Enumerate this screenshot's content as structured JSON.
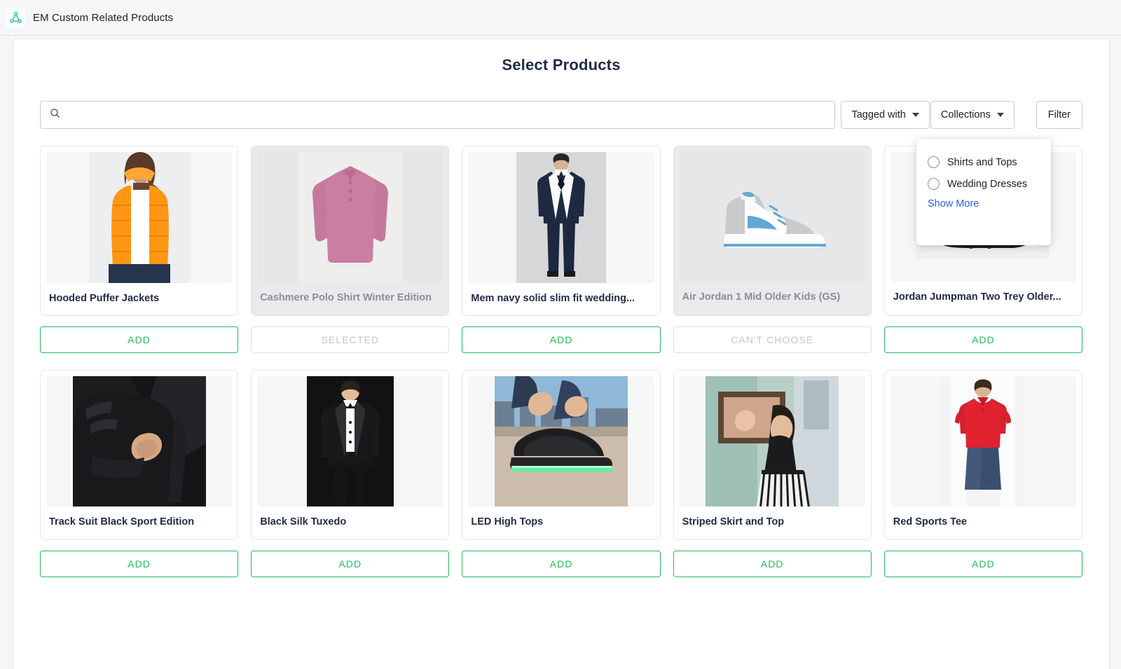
{
  "appbar": {
    "icon": "network-graph-icon",
    "title": "EM Custom Related Products",
    "accent": "#2ec4a6"
  },
  "page": {
    "title": "Select Products"
  },
  "search": {
    "icon": "search-icon",
    "value": "",
    "placeholder": ""
  },
  "toolbar": {
    "tagged_with_label": "Tagged with",
    "collections_label": "Collections",
    "filter_label": "Filter"
  },
  "collections_popover": {
    "options": [
      {
        "label": "Shirts and Tops",
        "selected": false
      },
      {
        "label": "Wedding Dresses",
        "selected": false
      }
    ],
    "show_more_label": "Show More",
    "link_color": "#2c5fe0"
  },
  "labels": {
    "add": "ADD",
    "selected": "SELECTED",
    "cant_choose": "CAN'T CHOOSE"
  },
  "colors": {
    "add_green": "#22bb5b",
    "muted": "#c3c6c9",
    "title": "#1f2b45"
  },
  "products": [
    {
      "title": "Hooded Puffer Jackets",
      "action": "ADD",
      "state": "default",
      "art": "puffer-jacket"
    },
    {
      "title": "Cashmere Polo Shirt Winter Edition",
      "action": "SELECTED",
      "state": "selected",
      "art": "polo-shirt"
    },
    {
      "title": "Mem navy solid slim fit wedding...",
      "action": "ADD",
      "state": "default",
      "art": "navy-suit"
    },
    {
      "title": "Air Jordan 1 Mid Older Kids (GS)",
      "action": "CAN'T CHOOSE",
      "state": "disabled",
      "art": "jordan-1-sneaker"
    },
    {
      "title": "Jordan Jumpman Two Trey Older...",
      "action": "ADD",
      "state": "default",
      "art": "jumpman-sneaker"
    },
    {
      "title": "Track Suit Black Sport Edition",
      "action": "ADD",
      "state": "default",
      "art": "track-suit"
    },
    {
      "title": "Black Silk Tuxedo",
      "action": "ADD",
      "state": "default",
      "art": "black-tuxedo"
    },
    {
      "title": "LED High Tops",
      "action": "ADD",
      "state": "default",
      "art": "led-high-tops"
    },
    {
      "title": "Striped Skirt and Top",
      "action": "ADD",
      "state": "default",
      "art": "striped-skirt"
    },
    {
      "title": "Red Sports Tee",
      "action": "ADD",
      "state": "default",
      "art": "red-tee"
    }
  ]
}
